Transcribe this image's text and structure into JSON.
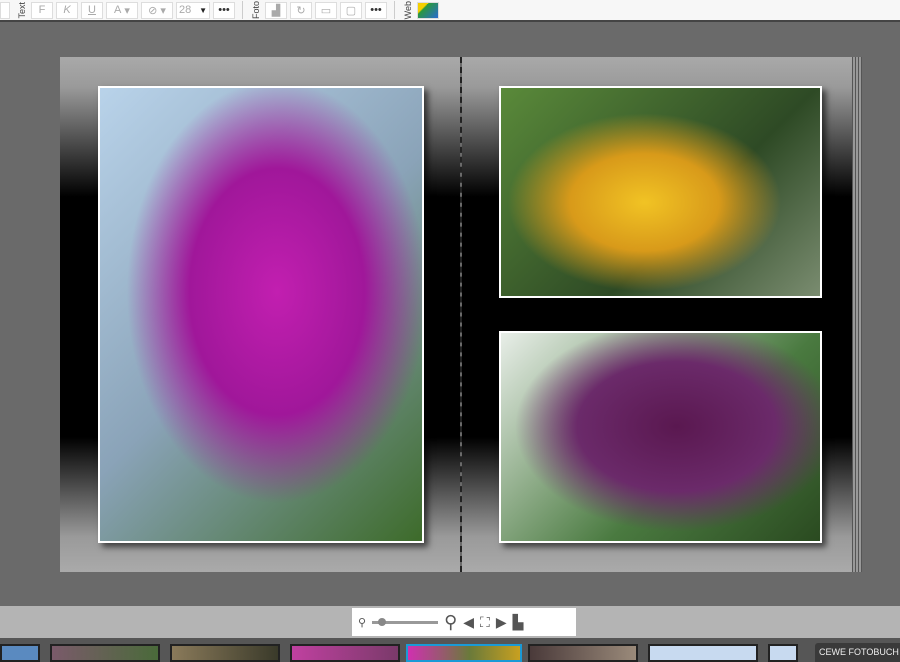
{
  "toolbar": {
    "text_label": "Text",
    "bold": "F",
    "italic": "K",
    "underline": "U",
    "font_color": "A",
    "highlight": "⊘",
    "font_size": "28",
    "more": "•••",
    "photo_label": "Foto",
    "web_label": "Web"
  },
  "zoom": {
    "level_percent": 10
  },
  "filmstrip": {
    "product_label": "CEWE FOTOBUCH G"
  }
}
